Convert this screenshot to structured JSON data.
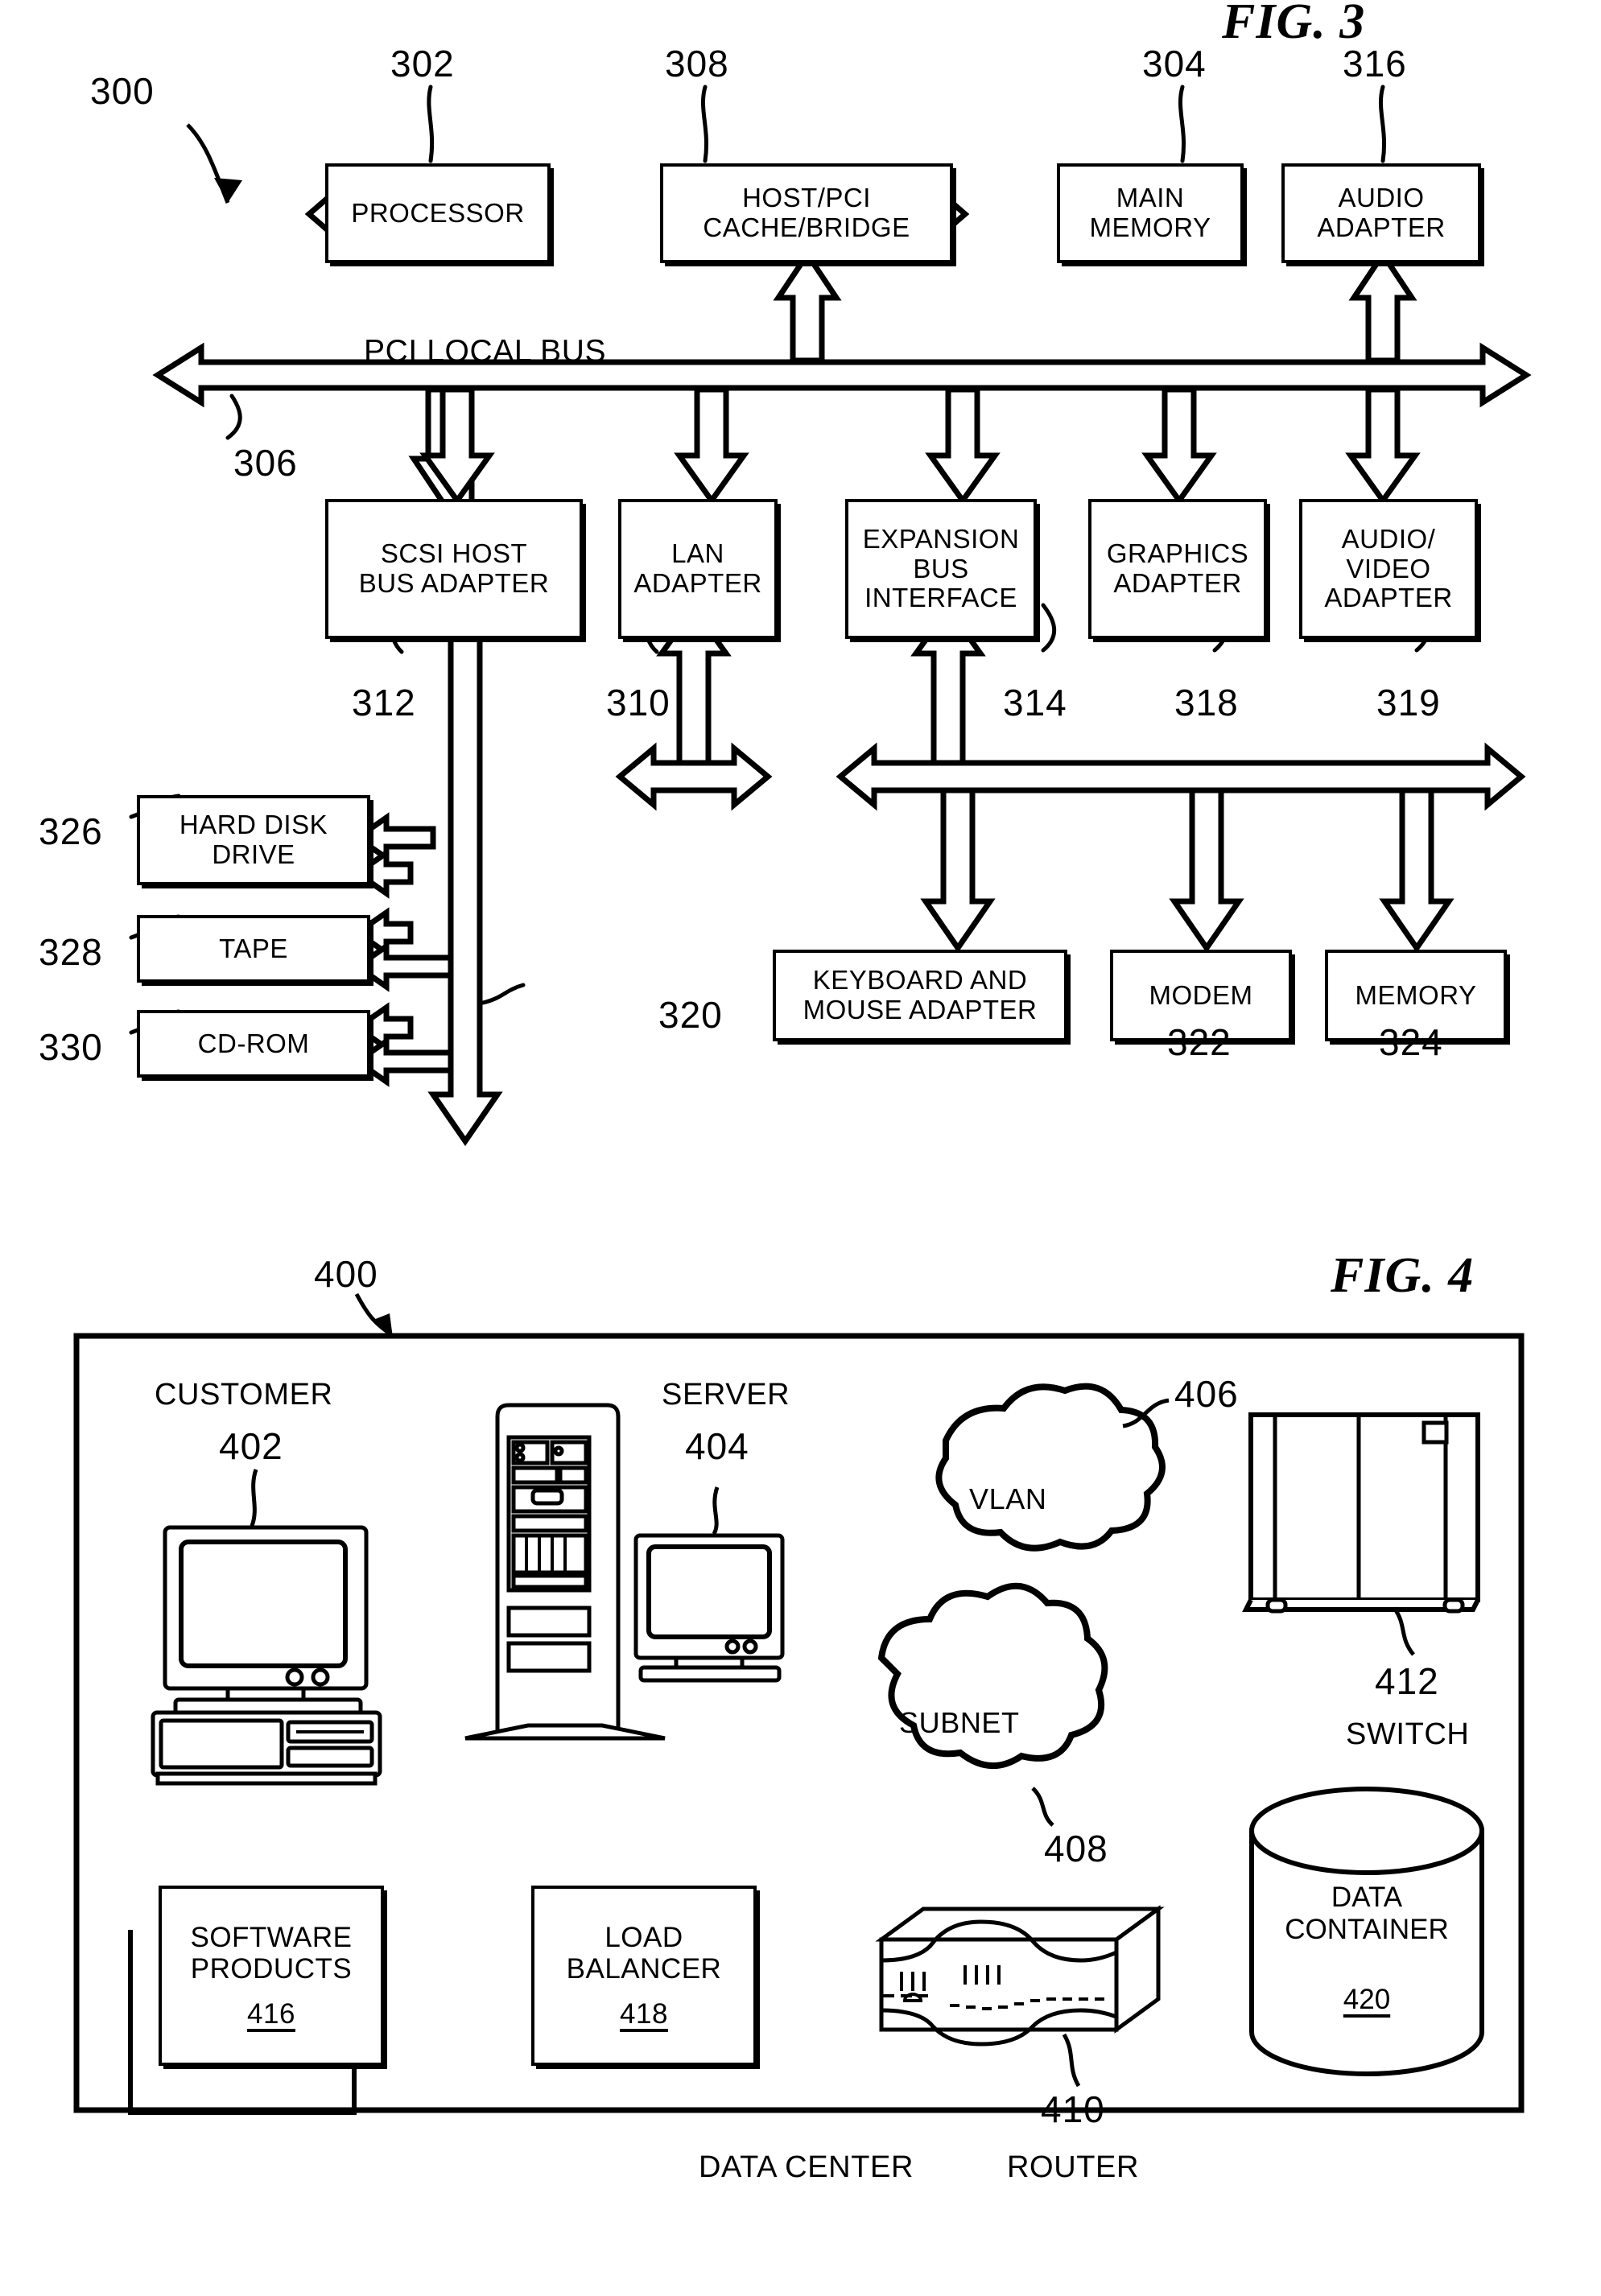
{
  "figures": [
    {
      "title": "FIG. 3",
      "ref": "300",
      "bus_label": "PCI LOCAL BUS",
      "bus_ref": "306",
      "top_row": [
        {
          "label": "PROCESSOR",
          "lines": [
            "PROCESSOR"
          ],
          "ref": "302"
        },
        {
          "label": "HOST/PCI CACHE/BRIDGE",
          "lines": [
            "HOST/PCI",
            "CACHE/BRIDGE"
          ],
          "ref": "308"
        },
        {
          "label": "MAIN MEMORY",
          "lines": [
            "MAIN",
            "MEMORY"
          ],
          "ref": "304"
        },
        {
          "label": "AUDIO ADAPTER",
          "lines": [
            "AUDIO",
            "ADAPTER"
          ],
          "ref": "316"
        }
      ],
      "adapter_row": [
        {
          "label": "SCSI HOST BUS ADAPTER",
          "lines": [
            "SCSI HOST",
            "BUS ADAPTER"
          ],
          "ref": "312"
        },
        {
          "label": "LAN ADAPTER",
          "lines": [
            "LAN",
            "ADAPTER"
          ],
          "ref": "310"
        },
        {
          "label": "EXPANSION BUS INTERFACE",
          "lines": [
            "EXPANSION",
            "BUS",
            "INTERFACE"
          ],
          "ref": "314"
        },
        {
          "label": "GRAPHICS ADAPTER",
          "lines": [
            "GRAPHICS",
            "ADAPTER"
          ],
          "ref": "318"
        },
        {
          "label": "AUDIO/ VIDEO ADAPTER",
          "lines": [
            "AUDIO/",
            "VIDEO",
            "ADAPTER"
          ],
          "ref": "319"
        }
      ],
      "storage_row": [
        {
          "label": "HARD DISK DRIVE",
          "lines": [
            "HARD DISK",
            "DRIVE"
          ],
          "ref": "326"
        },
        {
          "label": "TAPE",
          "lines": [
            "TAPE"
          ],
          "ref": "328"
        },
        {
          "label": "CD-ROM",
          "lines": [
            "CD-ROM"
          ],
          "ref": "330"
        }
      ],
      "expansion_row": [
        {
          "label": "KEYBOARD AND MOUSE ADAPTER",
          "lines": [
            "KEYBOARD AND",
            "MOUSE ADAPTER"
          ],
          "ref": "320"
        },
        {
          "label": "MODEM",
          "lines": [
            "MODEM"
          ],
          "ref": "322"
        },
        {
          "label": "MEMORY",
          "lines": [
            "MEMORY"
          ],
          "ref": "324"
        }
      ]
    },
    {
      "title": "FIG. 4",
      "ref": "400",
      "frame_label": "DATA CENTER",
      "items": [
        {
          "name": "customer-workstation",
          "label": "CUSTOMER",
          "ref": "402"
        },
        {
          "name": "server",
          "label": "SERVER",
          "ref": "404"
        },
        {
          "name": "vlan-cloud",
          "label": "VLAN",
          "ref": "406"
        },
        {
          "name": "subnet-cloud",
          "label": "SUBNET",
          "ref": "408"
        },
        {
          "name": "router",
          "label": "ROUTER",
          "ref": "410"
        },
        {
          "name": "switch",
          "label": "SWITCH",
          "ref": "412"
        },
        {
          "name": "software-products",
          "label": "SOFTWARE PRODUCTS",
          "lines": [
            "SOFTWARE",
            "PRODUCTS"
          ],
          "ref": "416"
        },
        {
          "name": "load-balancer",
          "label": "LOAD BALANCER",
          "lines": [
            "LOAD",
            "BALANCER"
          ],
          "ref": "418"
        },
        {
          "name": "data-container",
          "label": "DATA CONTAINER",
          "lines": [
            "DATA",
            "CONTAINER"
          ],
          "ref": "420"
        }
      ]
    }
  ]
}
